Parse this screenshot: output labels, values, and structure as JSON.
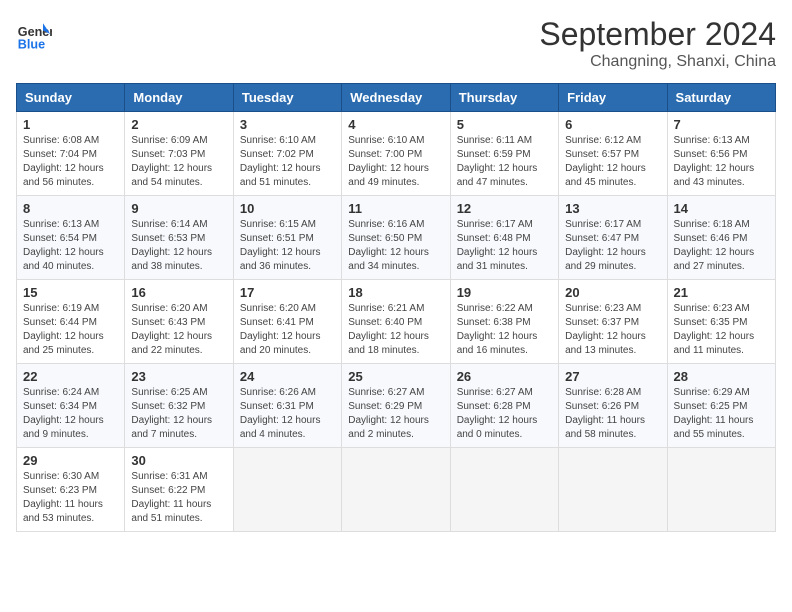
{
  "logo": {
    "line1": "General",
    "line2": "Blue"
  },
  "header": {
    "month": "September 2024",
    "location": "Changning, Shanxi, China"
  },
  "weekdays": [
    "Sunday",
    "Monday",
    "Tuesday",
    "Wednesday",
    "Thursday",
    "Friday",
    "Saturday"
  ],
  "weeks": [
    [
      {
        "day": "1",
        "sunrise": "6:08 AM",
        "sunset": "7:04 PM",
        "daylight": "12 hours and 56 minutes."
      },
      {
        "day": "2",
        "sunrise": "6:09 AM",
        "sunset": "7:03 PM",
        "daylight": "12 hours and 54 minutes."
      },
      {
        "day": "3",
        "sunrise": "6:10 AM",
        "sunset": "7:02 PM",
        "daylight": "12 hours and 51 minutes."
      },
      {
        "day": "4",
        "sunrise": "6:10 AM",
        "sunset": "7:00 PM",
        "daylight": "12 hours and 49 minutes."
      },
      {
        "day": "5",
        "sunrise": "6:11 AM",
        "sunset": "6:59 PM",
        "daylight": "12 hours and 47 minutes."
      },
      {
        "day": "6",
        "sunrise": "6:12 AM",
        "sunset": "6:57 PM",
        "daylight": "12 hours and 45 minutes."
      },
      {
        "day": "7",
        "sunrise": "6:13 AM",
        "sunset": "6:56 PM",
        "daylight": "12 hours and 43 minutes."
      }
    ],
    [
      {
        "day": "8",
        "sunrise": "6:13 AM",
        "sunset": "6:54 PM",
        "daylight": "12 hours and 40 minutes."
      },
      {
        "day": "9",
        "sunrise": "6:14 AM",
        "sunset": "6:53 PM",
        "daylight": "12 hours and 38 minutes."
      },
      {
        "day": "10",
        "sunrise": "6:15 AM",
        "sunset": "6:51 PM",
        "daylight": "12 hours and 36 minutes."
      },
      {
        "day": "11",
        "sunrise": "6:16 AM",
        "sunset": "6:50 PM",
        "daylight": "12 hours and 34 minutes."
      },
      {
        "day": "12",
        "sunrise": "6:17 AM",
        "sunset": "6:48 PM",
        "daylight": "12 hours and 31 minutes."
      },
      {
        "day": "13",
        "sunrise": "6:17 AM",
        "sunset": "6:47 PM",
        "daylight": "12 hours and 29 minutes."
      },
      {
        "day": "14",
        "sunrise": "6:18 AM",
        "sunset": "6:46 PM",
        "daylight": "12 hours and 27 minutes."
      }
    ],
    [
      {
        "day": "15",
        "sunrise": "6:19 AM",
        "sunset": "6:44 PM",
        "daylight": "12 hours and 25 minutes."
      },
      {
        "day": "16",
        "sunrise": "6:20 AM",
        "sunset": "6:43 PM",
        "daylight": "12 hours and 22 minutes."
      },
      {
        "day": "17",
        "sunrise": "6:20 AM",
        "sunset": "6:41 PM",
        "daylight": "12 hours and 20 minutes."
      },
      {
        "day": "18",
        "sunrise": "6:21 AM",
        "sunset": "6:40 PM",
        "daylight": "12 hours and 18 minutes."
      },
      {
        "day": "19",
        "sunrise": "6:22 AM",
        "sunset": "6:38 PM",
        "daylight": "12 hours and 16 minutes."
      },
      {
        "day": "20",
        "sunrise": "6:23 AM",
        "sunset": "6:37 PM",
        "daylight": "12 hours and 13 minutes."
      },
      {
        "day": "21",
        "sunrise": "6:23 AM",
        "sunset": "6:35 PM",
        "daylight": "12 hours and 11 minutes."
      }
    ],
    [
      {
        "day": "22",
        "sunrise": "6:24 AM",
        "sunset": "6:34 PM",
        "daylight": "12 hours and 9 minutes."
      },
      {
        "day": "23",
        "sunrise": "6:25 AM",
        "sunset": "6:32 PM",
        "daylight": "12 hours and 7 minutes."
      },
      {
        "day": "24",
        "sunrise": "6:26 AM",
        "sunset": "6:31 PM",
        "daylight": "12 hours and 4 minutes."
      },
      {
        "day": "25",
        "sunrise": "6:27 AM",
        "sunset": "6:29 PM",
        "daylight": "12 hours and 2 minutes."
      },
      {
        "day": "26",
        "sunrise": "6:27 AM",
        "sunset": "6:28 PM",
        "daylight": "12 hours and 0 minutes."
      },
      {
        "day": "27",
        "sunrise": "6:28 AM",
        "sunset": "6:26 PM",
        "daylight": "11 hours and 58 minutes."
      },
      {
        "day": "28",
        "sunrise": "6:29 AM",
        "sunset": "6:25 PM",
        "daylight": "11 hours and 55 minutes."
      }
    ],
    [
      {
        "day": "29",
        "sunrise": "6:30 AM",
        "sunset": "6:23 PM",
        "daylight": "11 hours and 53 minutes."
      },
      {
        "day": "30",
        "sunrise": "6:31 AM",
        "sunset": "6:22 PM",
        "daylight": "11 hours and 51 minutes."
      },
      null,
      null,
      null,
      null,
      null
    ]
  ]
}
